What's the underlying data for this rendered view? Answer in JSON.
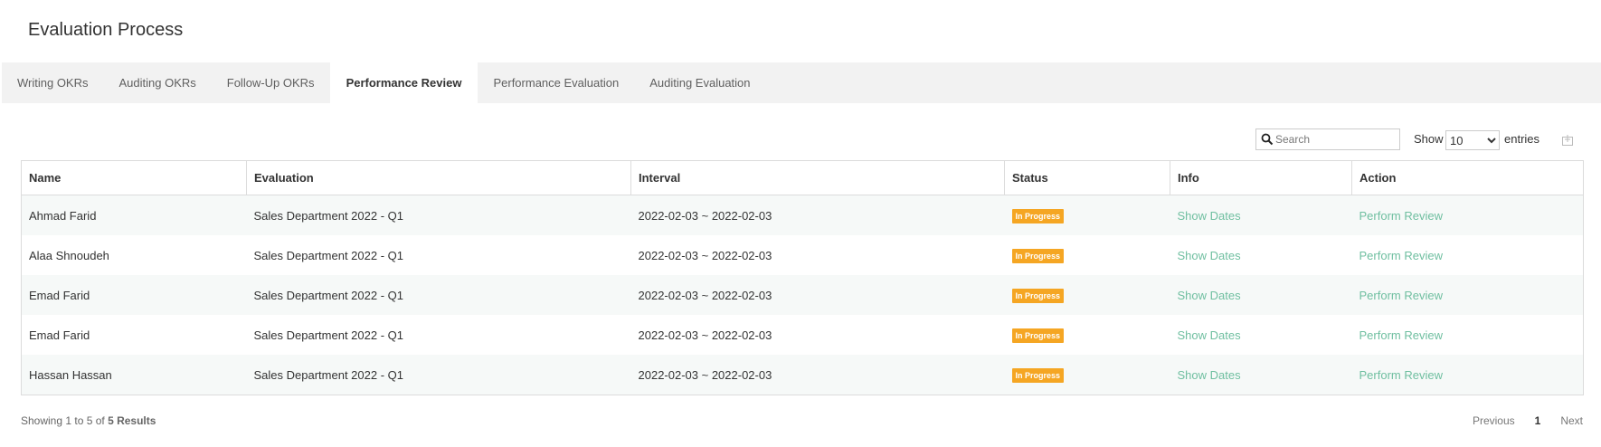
{
  "page": {
    "title": "Evaluation Process"
  },
  "tabs": [
    {
      "label": "Writing OKRs"
    },
    {
      "label": "Auditing OKRs"
    },
    {
      "label": "Follow-Up OKRs"
    },
    {
      "label": "Performance Review",
      "active": true
    },
    {
      "label": "Performance Evaluation"
    },
    {
      "label": "Auditing Evaluation"
    }
  ],
  "toolbar": {
    "search_placeholder": "Search",
    "show_label": "Show",
    "page_length": "10",
    "entries_label": "entries"
  },
  "table": {
    "columns": [
      "Name",
      "Evaluation",
      "Interval",
      "Status",
      "Info",
      "Action"
    ],
    "rows": [
      {
        "name": "Ahmad Farid",
        "evaluation": "Sales Department 2022 - Q1",
        "interval": "2022-02-03 ~ 2022-02-03",
        "status": "In Progress",
        "info": "Show Dates",
        "action": "Perform Review"
      },
      {
        "name": "Alaa Shnoudeh",
        "evaluation": "Sales Department 2022 - Q1",
        "interval": "2022-02-03 ~ 2022-02-03",
        "status": "In Progress",
        "info": "Show Dates",
        "action": "Perform Review"
      },
      {
        "name": "Emad Farid",
        "evaluation": "Sales Department 2022 - Q1",
        "interval": "2022-02-03 ~ 2022-02-03",
        "status": "In Progress",
        "info": "Show Dates",
        "action": "Perform Review"
      },
      {
        "name": "Emad Farid",
        "evaluation": "Sales Department 2022 - Q1",
        "interval": "2022-02-03 ~ 2022-02-03",
        "status": "In Progress",
        "info": "Show Dates",
        "action": "Perform Review"
      },
      {
        "name": "Hassan Hassan",
        "evaluation": "Sales Department 2022 - Q1",
        "interval": "2022-02-03 ~ 2022-02-03",
        "status": "In Progress",
        "info": "Show Dates",
        "action": "Perform Review"
      }
    ]
  },
  "footer": {
    "info_prefix": "Showing 1 to 5 of",
    "info_total": "5 Results",
    "previous": "Previous",
    "current_page": "1",
    "next": "Next"
  },
  "colors": {
    "status_in_progress": "#f5a623",
    "link": "#6fbfa0",
    "tabbar_bg": "#f2f2f2"
  },
  "icons": {
    "search": "search-icon",
    "export": "export-icon"
  }
}
